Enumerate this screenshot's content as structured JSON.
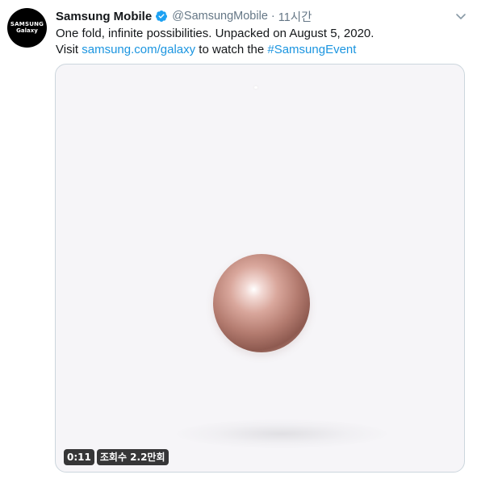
{
  "account": {
    "avatar_brand": "SAMSUNG",
    "avatar_sub": "Galaxy",
    "name": "Samsung Mobile",
    "handle": "@SamsungMobile",
    "separator": "·",
    "time": "11시간"
  },
  "tweet": {
    "line1": "One fold, infinite possibilities. Unpacked on August 5, 2020.",
    "visit_prefix": "Visit ",
    "link_text": "samsung.com/galaxy",
    "middle_text": " to watch the ",
    "hashtag": "#SamsungEvent"
  },
  "video": {
    "duration": "0:11",
    "views": "조회수 2.2만회"
  },
  "colors": {
    "link": "#1b95e0",
    "verified": "#1da1f2",
    "text": "#14171a",
    "muted": "#657786"
  },
  "icons": {
    "verified": "verified-badge-icon",
    "menu": "chevron-down-icon"
  }
}
